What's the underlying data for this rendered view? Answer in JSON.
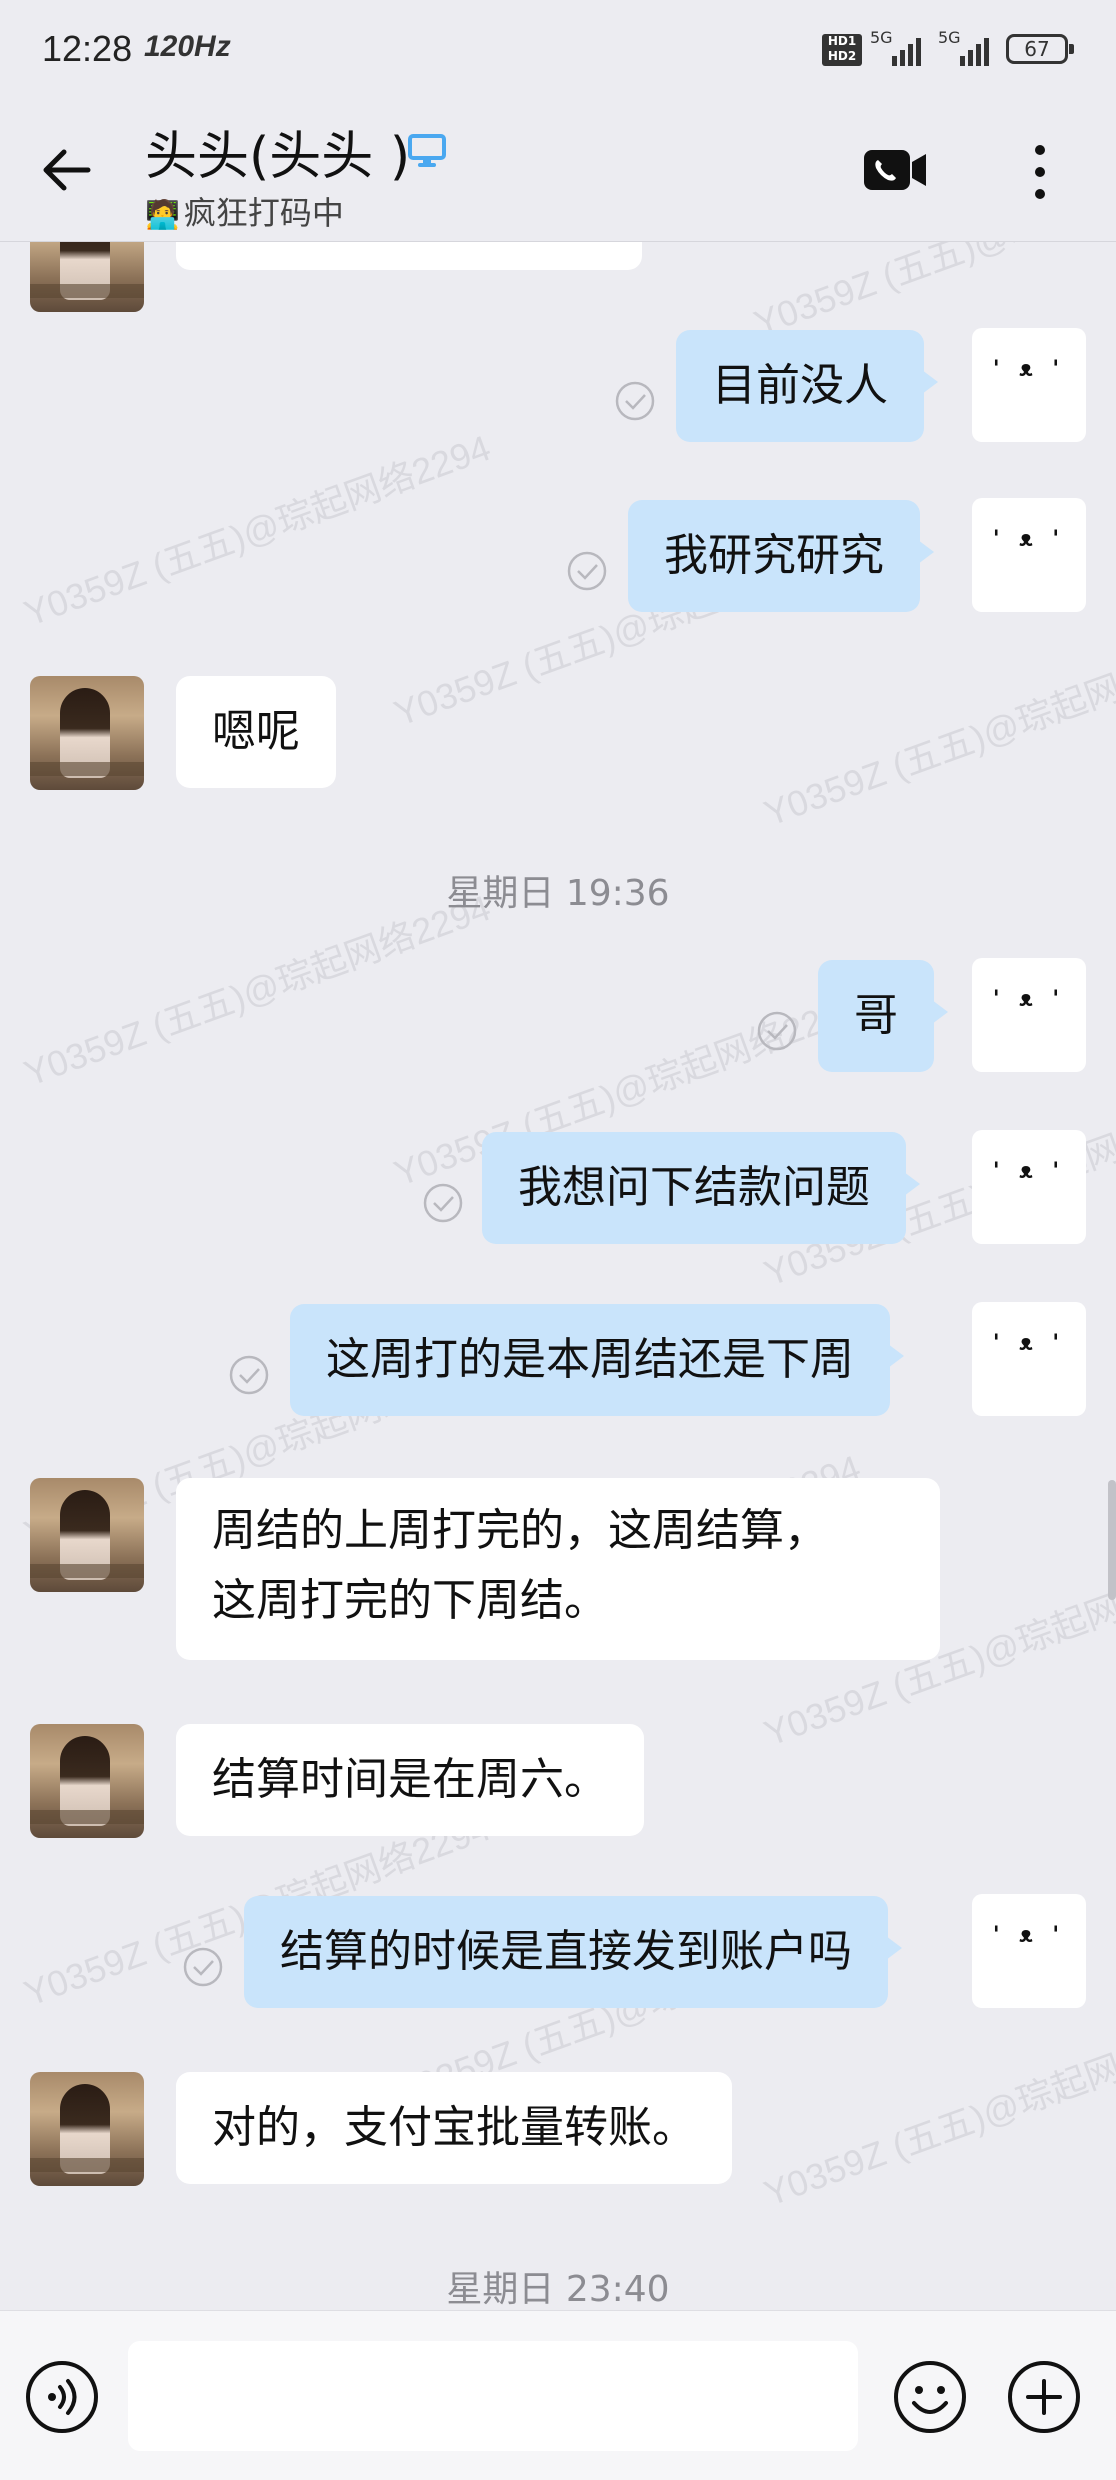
{
  "status_bar": {
    "time": "12:28",
    "refresh_rate": "120Hz",
    "hd_label": "HD1 HD2",
    "network1": "5G",
    "network2": "5G",
    "battery": "67"
  },
  "header": {
    "title": "头头(头头 )",
    "status_emoji": "🧑‍💻",
    "status_text": "疯狂打码中"
  },
  "watermark_text": "Y0359Z (五五)@琮起网络2294",
  "self_avatar_face": "' ᴥ '",
  "messages": [
    {
      "side": "out",
      "text": "目前没人",
      "read": true
    },
    {
      "side": "out",
      "text": "我研究研究",
      "read": true
    },
    {
      "side": "in",
      "text": "嗯呢"
    },
    {
      "type": "time",
      "text": "星期日  19:36"
    },
    {
      "side": "out",
      "text": "哥",
      "read": true
    },
    {
      "side": "out",
      "text": "我想问下结款问题",
      "read": true
    },
    {
      "side": "out",
      "text": "这周打的是本周结还是下周",
      "read": true
    },
    {
      "side": "in",
      "lines": [
        "周结的上周打完的，这周结算，",
        "这周打完的下周结。"
      ]
    },
    {
      "side": "in",
      "text": "结算时间是在周六。"
    },
    {
      "side": "out",
      "text": "结算的时候是直接发到账户吗",
      "read": true
    },
    {
      "side": "in",
      "text": "对的，支付宝批量转账。"
    },
    {
      "type": "time",
      "text": "星期日  23:40"
    }
  ],
  "input": {
    "value": "",
    "placeholder": ""
  },
  "colors": {
    "background": "#ececf1",
    "outgoing_bubble": "#c9e4fb",
    "incoming_bubble": "#ffffff",
    "online_icon": "#4aa8f0"
  }
}
